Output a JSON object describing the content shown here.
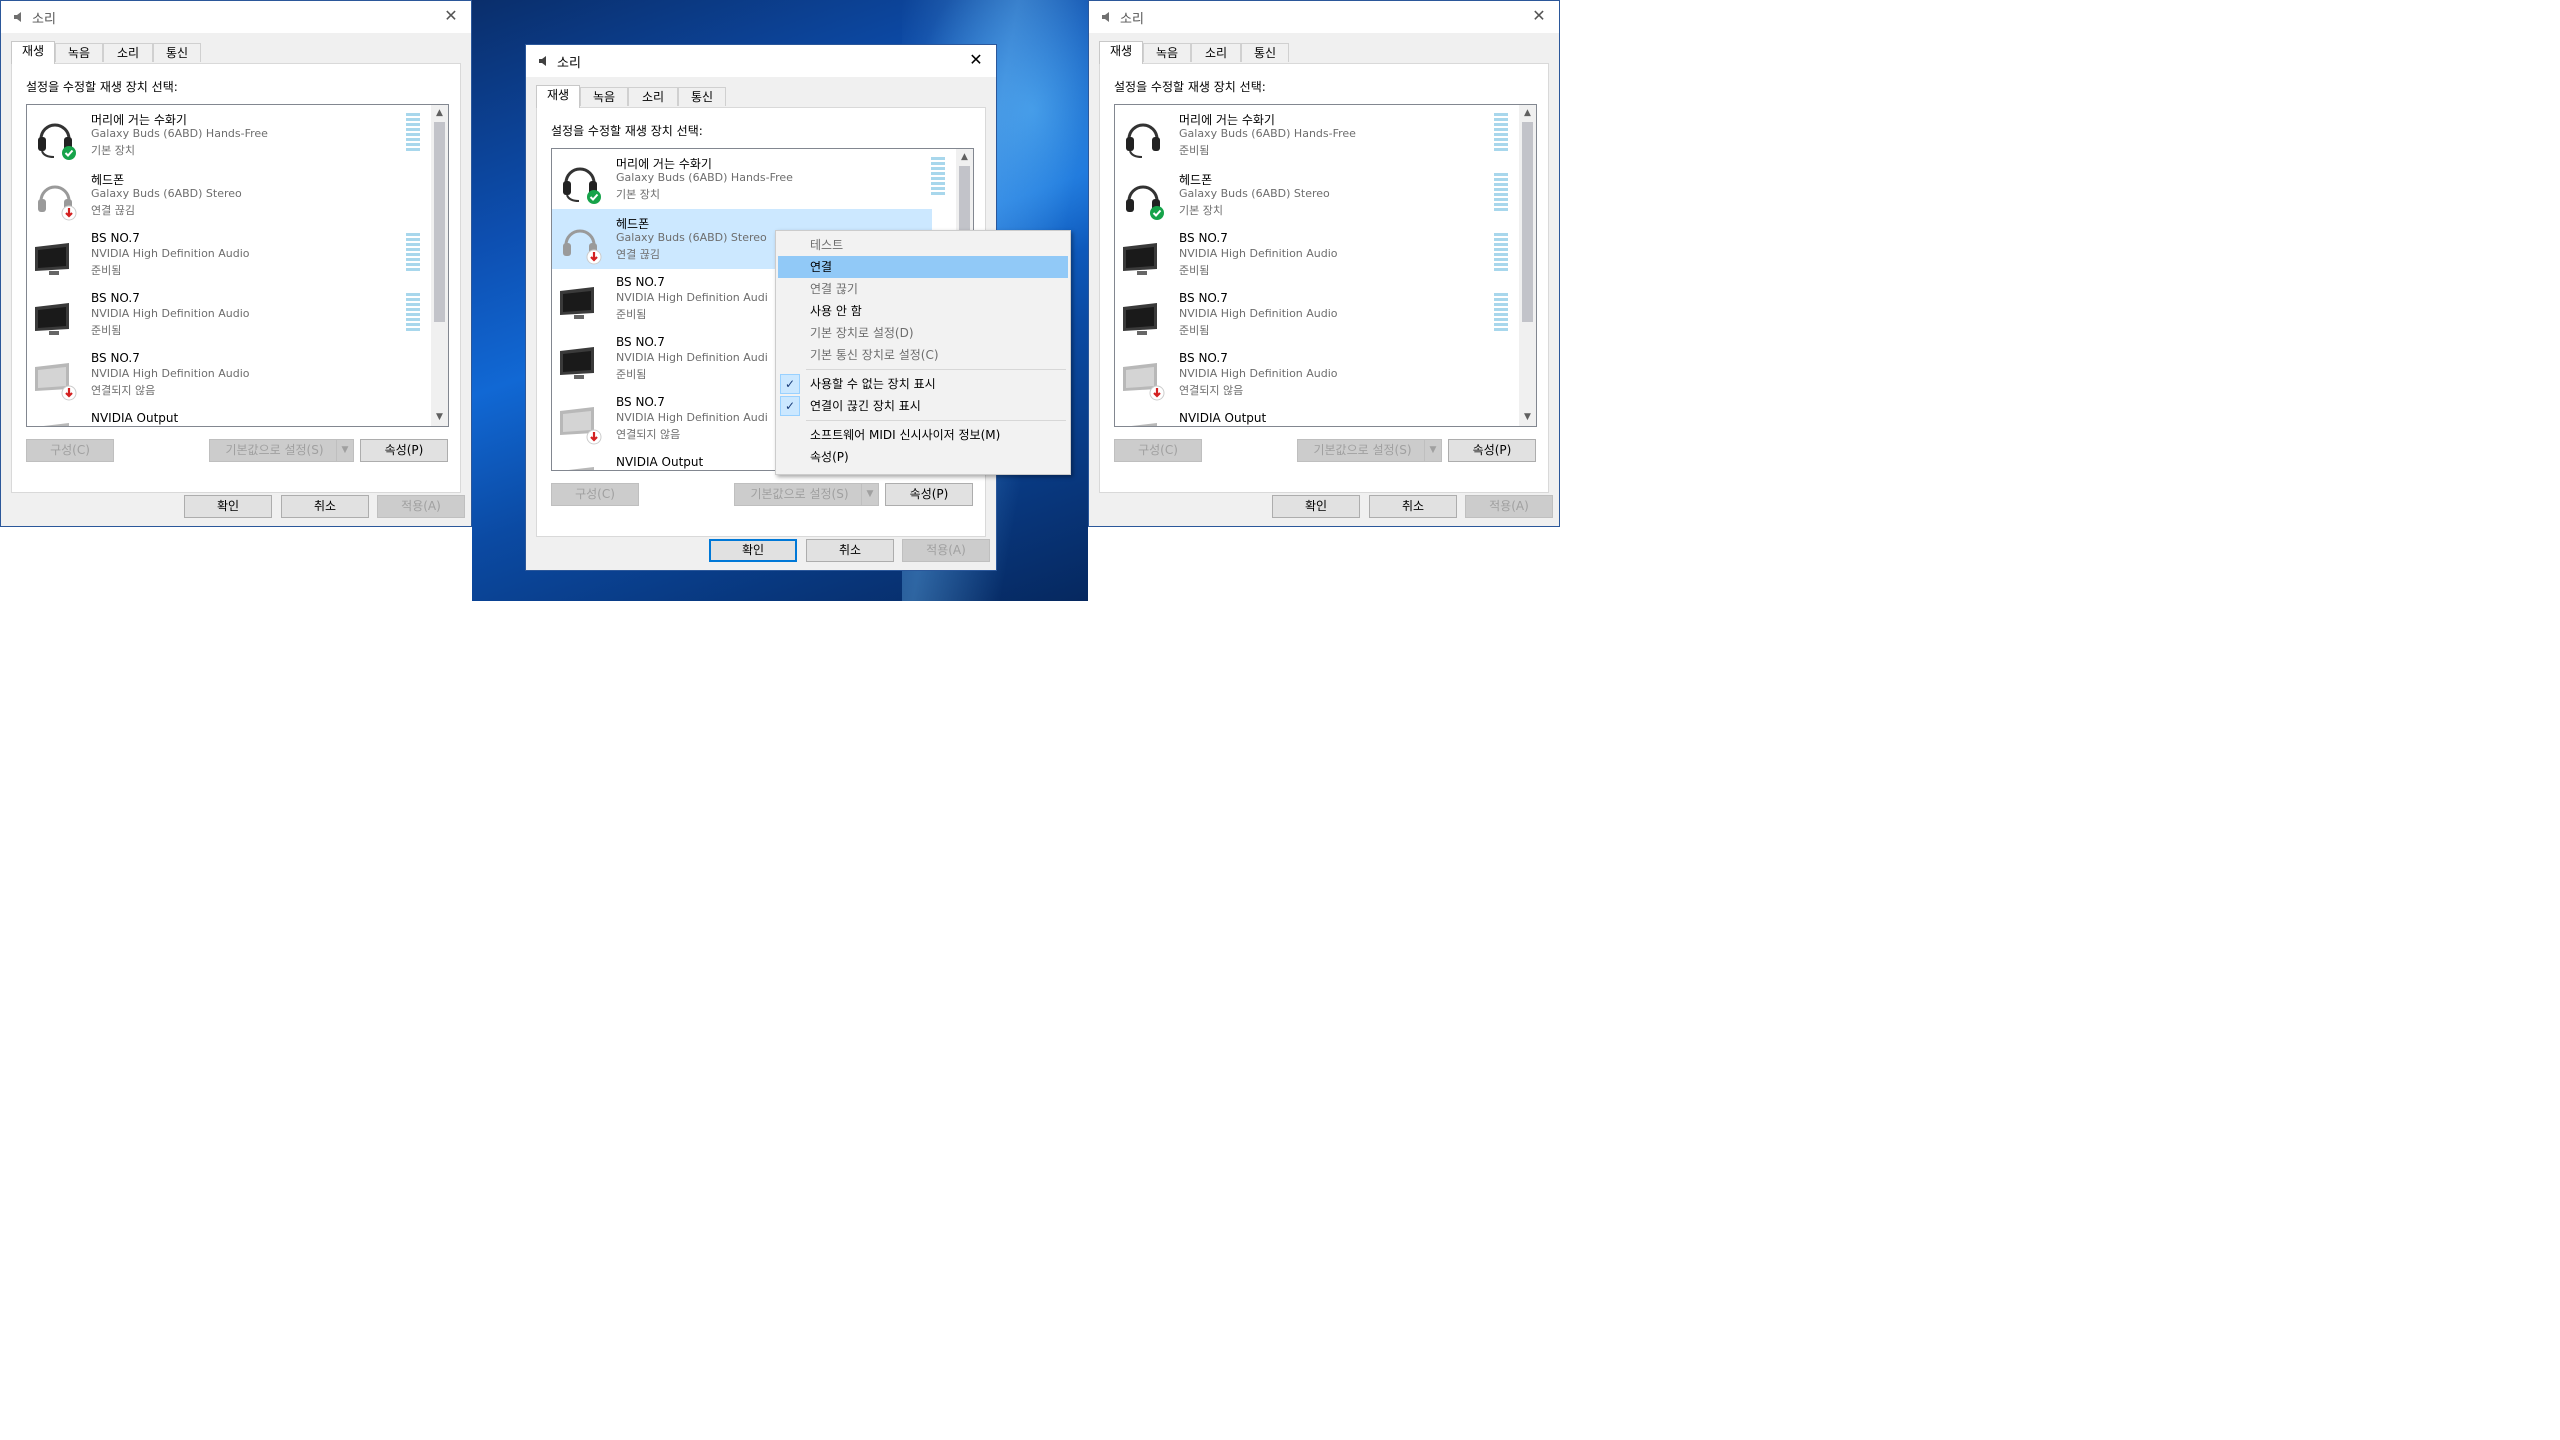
{
  "windows": [
    {
      "title": "소리",
      "close_glyph": "✕",
      "tabs": [
        "재생",
        "녹음",
        "소리",
        "통신"
      ],
      "instruction": "설정을 수정할 재생 장치 선택:",
      "devices": [
        {
          "name": "머리에 거는 수화기",
          "driver": "Galaxy Buds (6ABD) Hands-Free",
          "status": "기본 장치",
          "icon": "headset-icon",
          "badge": "default-check-badge"
        },
        {
          "name": "헤드폰",
          "driver": "Galaxy Buds (6ABD) Stereo",
          "status": "연결 끊김",
          "icon": "headphones-icon",
          "badge": "disconnected-arrow-badge"
        },
        {
          "name": "BS NO.7",
          "driver": "NVIDIA High Definition Audio",
          "status": "준비됨",
          "icon": "monitor-icon",
          "badge": ""
        },
        {
          "name": "BS NO.7",
          "driver": "NVIDIA High Definition Audio",
          "status": "준비됨",
          "icon": "monitor-icon",
          "badge": ""
        },
        {
          "name": "BS NO.7",
          "driver": "NVIDIA High Definition Audio",
          "status": "연결되지 않음",
          "icon": "monitor-icon",
          "badge": "disconnected-arrow-badge"
        },
        {
          "name": "NVIDIA Output",
          "driver": "",
          "status": "",
          "icon": "monitor-icon",
          "badge": ""
        }
      ],
      "buttons": {
        "configure": "구성(C)",
        "set_default": "기본값으로 설정(S)",
        "properties": "속성(P)",
        "ok": "확인",
        "cancel": "취소",
        "apply": "적용(A)"
      }
    },
    {
      "title": "소리",
      "close_glyph": "✕",
      "tabs": [
        "재생",
        "녹음",
        "소리",
        "통신"
      ],
      "instruction": "설정을 수정할 재생 장치 선택:",
      "devices": [
        {
          "name": "머리에 거는 수화기",
          "driver": "Galaxy Buds (6ABD) Hands-Free",
          "status": "기본 장치",
          "icon": "headset-icon",
          "badge": "default-check-badge"
        },
        {
          "name": "헤드폰",
          "driver": "Galaxy Buds (6ABD) Stereo",
          "status": "연결 끊김",
          "icon": "headphones-icon",
          "badge": "disconnected-arrow-badge"
        },
        {
          "name": "BS NO.7",
          "driver": "NVIDIA High Definition Audi",
          "status": "준비됨",
          "icon": "monitor-icon",
          "badge": ""
        },
        {
          "name": "BS NO.7",
          "driver": "NVIDIA High Definition Audi",
          "status": "준비됨",
          "icon": "monitor-icon",
          "badge": ""
        },
        {
          "name": "BS NO.7",
          "driver": "NVIDIA High Definition Audi",
          "status": "연결되지 않음",
          "icon": "monitor-icon",
          "badge": "disconnected-arrow-badge"
        },
        {
          "name": "NVIDIA Output",
          "driver": "",
          "status": "",
          "icon": "monitor-icon",
          "badge": ""
        }
      ],
      "buttons": {
        "configure": "구성(C)",
        "set_default": "기본값으로 설정(S)",
        "properties": "속성(P)",
        "ok": "확인",
        "cancel": "취소",
        "apply": "적용(A)"
      },
      "context_menu": [
        {
          "label": "테스트",
          "state": "disabled"
        },
        {
          "label": "연결",
          "state": "hover"
        },
        {
          "label": "연결 끊기",
          "state": "disabled"
        },
        {
          "label": "사용 안 함",
          "state": "normal"
        },
        {
          "label": "기본 장치로 설정(D)",
          "state": "disabled"
        },
        {
          "label": "기본 통신 장치로 설정(C)",
          "state": "disabled"
        },
        {
          "label": "사용할 수 없는 장치 표시",
          "state": "checked"
        },
        {
          "label": "연결이 끊긴 장치 표시",
          "state": "checked"
        },
        {
          "label": "소프트웨어 MIDI 신시사이저 정보(M)",
          "state": "normal"
        },
        {
          "label": "속성(P)",
          "state": "normal"
        }
      ],
      "check_glyph": "✓"
    },
    {
      "title": "소리",
      "close_glyph": "✕",
      "tabs": [
        "재생",
        "녹음",
        "소리",
        "통신"
      ],
      "instruction": "설정을 수정할 재생 장치 선택:",
      "devices": [
        {
          "name": "머리에 거는 수화기",
          "driver": "Galaxy Buds (6ABD) Hands-Free",
          "status": "준비됨",
          "icon": "headset-icon",
          "badge": ""
        },
        {
          "name": "헤드폰",
          "driver": "Galaxy Buds (6ABD) Stereo",
          "status": "기본 장치",
          "icon": "headphones-icon",
          "badge": "default-check-badge"
        },
        {
          "name": "BS NO.7",
          "driver": "NVIDIA High Definition Audio",
          "status": "준비됨",
          "icon": "monitor-icon",
          "badge": ""
        },
        {
          "name": "BS NO.7",
          "driver": "NVIDIA High Definition Audio",
          "status": "준비됨",
          "icon": "monitor-icon",
          "badge": ""
        },
        {
          "name": "BS NO.7",
          "driver": "NVIDIA High Definition Audio",
          "status": "연결되지 않음",
          "icon": "monitor-icon",
          "badge": "disconnected-arrow-badge"
        },
        {
          "name": "NVIDIA Output",
          "driver": "",
          "status": "",
          "icon": "monitor-icon",
          "badge": ""
        }
      ],
      "buttons": {
        "configure": "구성(C)",
        "set_default": "기본값으로 설정(S)",
        "properties": "속성(P)",
        "ok": "확인",
        "cancel": "취소",
        "apply": "적용(A)"
      }
    }
  ],
  "colors": {
    "selection": "#cce8ff",
    "menu_hover": "#91c9f7",
    "default_badge": "#16a34a",
    "disconnect_badge": "#d32020",
    "accent_border": "#2b579a"
  }
}
